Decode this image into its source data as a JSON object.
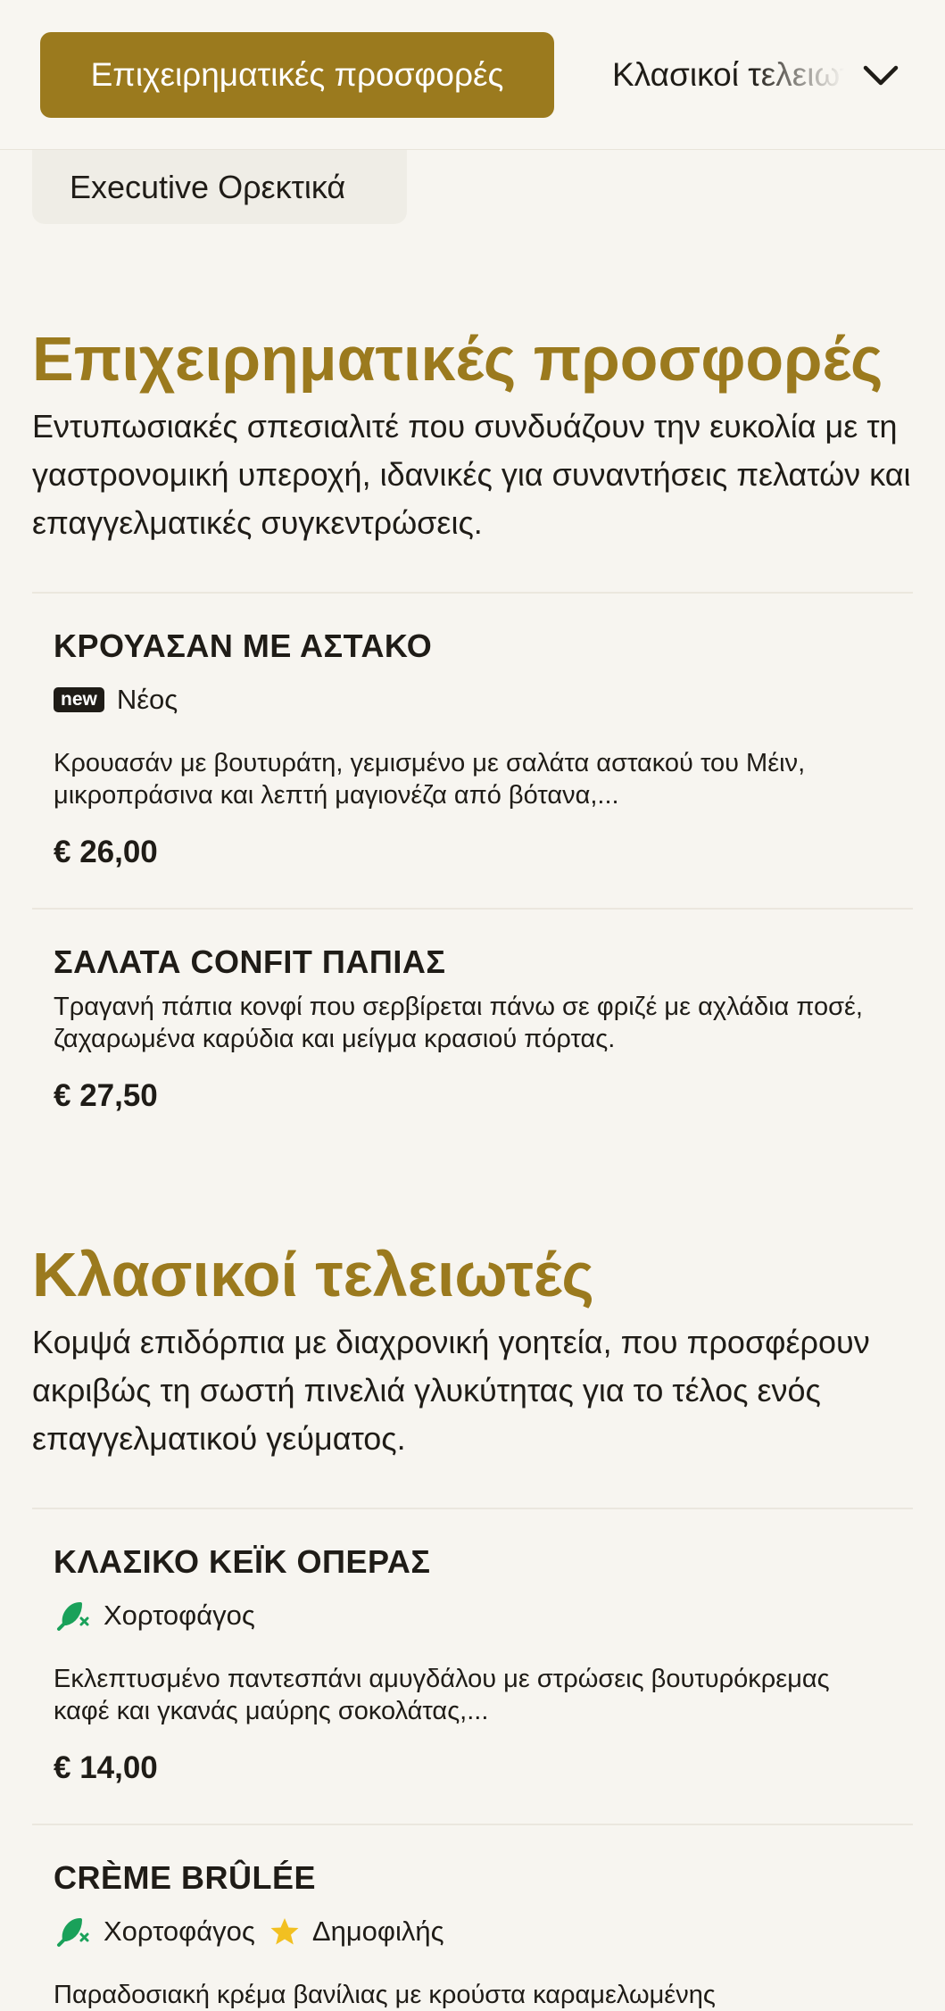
{
  "nav": {
    "tabs": [
      {
        "label": "Επιχειρηματικές προσφορές",
        "active": true
      },
      {
        "label": "Κλασικοί τελειωτές",
        "active": false
      }
    ],
    "chevron_icon": "chevron-down-icon",
    "subcategory": "Executive Ορεκτικά"
  },
  "sections": [
    {
      "title": "Επιχειρηματικές προσφορές",
      "description": "Εντυπωσιακές σπεσιαλιτέ που συνδυάζουν την ευκολία με τη γαστρονομική υπεροχή, ιδανικές για συναντήσεις πελατών και επαγγελματικές συγκεντρώσεις.",
      "items": [
        {
          "name": "ΚΡΟΥΑΣΑΝ ΜΕ ΑΣΤΑΚΟ",
          "tags": [
            {
              "badge": "new",
              "label": "Νέος"
            }
          ],
          "description": "Κρουασάν με βουτυράτη, γεμισμένο με σαλάτα αστακού του Μέιν, μικροπράσινα και λεπτή μαγιονέζα από βότανα,...",
          "price": "€ 26,00"
        },
        {
          "name": "ΣΑΛΑΤΑ CONFIT ΠΑΠΙΑΣ",
          "tags": [],
          "description": "Τραγανή πάπια κονφί που σερβίρεται πάνω σε φριζέ με αχλάδια ποσέ, ζαχαρωμένα καρύδια και μείγμα κρασιού πόρτας.",
          "price": "€ 27,50"
        }
      ]
    },
    {
      "title": "Κλασικοί τελειωτές",
      "description": "Κομψά επιδόρπια με διαχρονική γοητεία, που προσφέρουν ακριβώς τη σωστή πινελιά γλυκύτητας για το τέλος ενός επαγγελματικού γεύματος.",
      "items": [
        {
          "name": "ΚΛΑΣΙΚΟ ΚΕΪΚ ΟΠΕΡΑΣ",
          "tags": [
            {
              "icon": "vegetarian-icon",
              "label": "Χορτοφάγος"
            }
          ],
          "description": "Εκλεπτυσμένο παντεσπάνι αμυγδάλου με στρώσεις βουτυρόκρεμας καφέ και γκανάς μαύρης σοκολάτας,...",
          "price": "€ 14,00"
        },
        {
          "name": "CRÈME BRÛLÉE",
          "tags": [
            {
              "icon": "vegetarian-icon",
              "label": "Χορτοφάγος"
            },
            {
              "icon": "star-icon",
              "label": "Δημοφιλής"
            }
          ],
          "description": "Παραδοσιακή κρέμα βανίλιας με κρούστα καραμελωμένης"
        }
      ]
    }
  ],
  "colors": {
    "accent": "#9b7a1e",
    "background": "#f7f5f0",
    "text": "#1f1c17",
    "vegetarian_green": "#1aa15a",
    "star_yellow": "#f2c021"
  }
}
